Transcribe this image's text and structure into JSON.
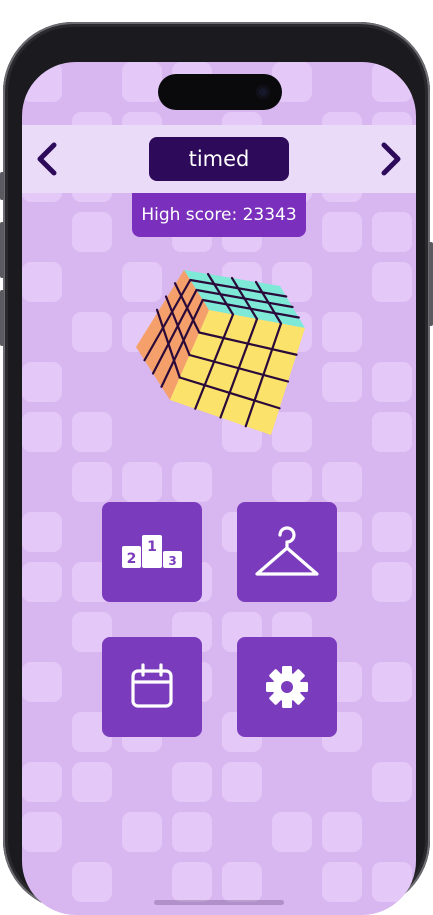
{
  "colors": {
    "background": "#d8b6ef",
    "tile": "#e4c8f7",
    "mode_bar": "#eadcf9",
    "mode_label_bg": "#2d0a5a",
    "accent": "#7a2fbd",
    "button": "#7a3cbd",
    "cube_top": "#7fe9d8",
    "cube_left": "#f5a06a",
    "cube_right": "#fbe26a"
  },
  "header": {
    "prev_icon": "chevron-left-icon",
    "mode": "timed",
    "next_icon": "chevron-right-icon"
  },
  "high_score": {
    "text": "High score: 23343"
  },
  "cube": {
    "icon": "rubiks-cube-icon"
  },
  "menu": [
    {
      "icon": "leaderboard-podium-icon",
      "name": "leaderboard"
    },
    {
      "icon": "hanger-icon",
      "name": "wardrobe"
    },
    {
      "icon": "calendar-icon",
      "name": "daily"
    },
    {
      "icon": "gear-icon",
      "name": "settings"
    }
  ],
  "podium": {
    "first": "1",
    "second": "2",
    "third": "3"
  }
}
